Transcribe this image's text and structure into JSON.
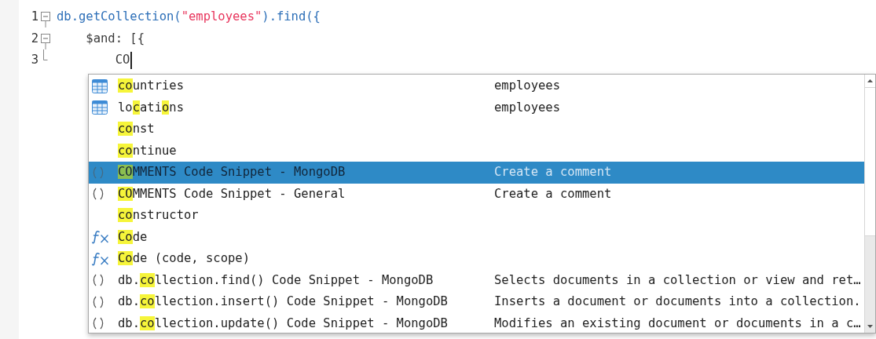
{
  "editor": {
    "lines": [
      {
        "number": "1",
        "kind": "fold-start",
        "tokens": [
          {
            "kind": "method",
            "text": "db.getCollection("
          },
          {
            "kind": "string",
            "text": "\"employees\""
          },
          {
            "kind": "method",
            "text": ").find({"
          }
        ]
      },
      {
        "number": "2",
        "kind": "fold-start",
        "tokens": [
          {
            "kind": "plain",
            "text": "    $and: [{"
          }
        ]
      },
      {
        "number": "3",
        "kind": "fold-end",
        "tokens": [
          {
            "kind": "plain",
            "text": "        CO"
          }
        ],
        "cursor": true
      }
    ]
  },
  "completion": {
    "items": [
      {
        "kind": "table",
        "selected": false,
        "segments": [
          {
            "text": "co",
            "match": true
          },
          {
            "text": "untries",
            "match": false
          }
        ],
        "detail": "employees"
      },
      {
        "kind": "table",
        "selected": false,
        "segments": [
          {
            "text": "lo",
            "match": false
          },
          {
            "text": "c",
            "match": true
          },
          {
            "text": "ati",
            "match": false
          },
          {
            "text": "o",
            "match": true
          },
          {
            "text": "ns",
            "match": false
          }
        ],
        "detail": "employees"
      },
      {
        "kind": "keyword",
        "selected": false,
        "segments": [
          {
            "text": "co",
            "match": true
          },
          {
            "text": "nst",
            "match": false
          }
        ]
      },
      {
        "kind": "keyword",
        "selected": false,
        "segments": [
          {
            "text": "co",
            "match": true
          },
          {
            "text": "ntinue",
            "match": false
          }
        ]
      },
      {
        "kind": "snippet",
        "selected": true,
        "segments": [
          {
            "text": "CO",
            "match": true
          },
          {
            "text": "MMENTS Code Snippet - MongoDB",
            "match": false
          }
        ],
        "detail": "Create a comment"
      },
      {
        "kind": "snippet",
        "selected": false,
        "segments": [
          {
            "text": "CO",
            "match": true
          },
          {
            "text": "MMENTS Code Snippet - General",
            "match": false
          }
        ],
        "detail": "Create a comment"
      },
      {
        "kind": "keyword",
        "selected": false,
        "segments": [
          {
            "text": "co",
            "match": true
          },
          {
            "text": "nstructor",
            "match": false
          }
        ]
      },
      {
        "kind": "function",
        "selected": false,
        "segments": [
          {
            "text": "Co",
            "match": true
          },
          {
            "text": "de",
            "match": false
          }
        ]
      },
      {
        "kind": "function",
        "selected": false,
        "segments": [
          {
            "text": "Co",
            "match": true
          },
          {
            "text": "de (code, scope)",
            "match": false
          }
        ]
      },
      {
        "kind": "snippet",
        "selected": false,
        "segments": [
          {
            "text": "db.",
            "match": false
          },
          {
            "text": "co",
            "match": true
          },
          {
            "text": "llection.find() Code Snippet - MongoDB",
            "match": false
          }
        ],
        "detail": "Selects documents in a collection or view and ret…"
      },
      {
        "kind": "snippet",
        "selected": false,
        "segments": [
          {
            "text": "db.",
            "match": false
          },
          {
            "text": "co",
            "match": true
          },
          {
            "text": "llection.insert() Code Snippet - MongoDB",
            "match": false
          }
        ],
        "detail": "Inserts a document or documents into a collection."
      },
      {
        "kind": "snippet",
        "selected": false,
        "segments": [
          {
            "text": "db.",
            "match": false
          },
          {
            "text": "co",
            "match": true
          },
          {
            "text": "llection.update() Code Snippet - MongoDB",
            "match": false
          }
        ],
        "detail": "Modifies an existing document or documents in a c…"
      }
    ]
  }
}
